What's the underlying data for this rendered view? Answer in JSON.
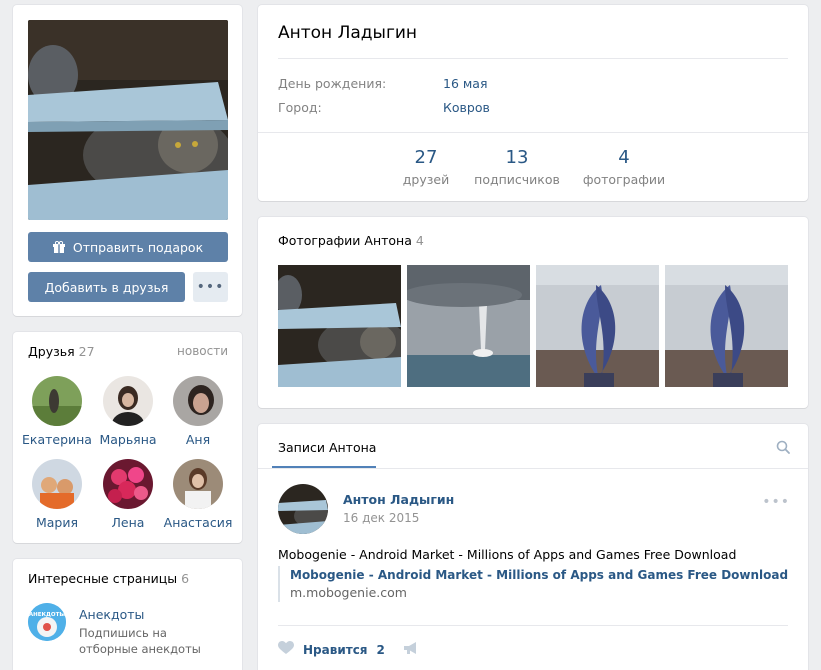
{
  "profile": {
    "name": "Антон Ладыгин",
    "info": [
      {
        "label": "День рождения:",
        "value": "16 мая"
      },
      {
        "label": "Город:",
        "value": "Ковров"
      }
    ],
    "stats": [
      {
        "count": "27",
        "label": "друзей"
      },
      {
        "count": "13",
        "label": "подписчиков"
      },
      {
        "count": "4",
        "label": "фотографии"
      }
    ]
  },
  "actions": {
    "gift_label": "Отправить подарок",
    "add_friend_label": "Добавить в друзья",
    "more_label": "•••"
  },
  "friends": {
    "title": "Друзья",
    "count": "27",
    "news_link": "новости",
    "items": [
      {
        "name": "Екатерина"
      },
      {
        "name": "Марьяна"
      },
      {
        "name": "Аня"
      },
      {
        "name": "Мария"
      },
      {
        "name": "Лена"
      },
      {
        "name": "Анастасия"
      }
    ]
  },
  "pages": {
    "title": "Интересные страницы",
    "count": "6",
    "items": [
      {
        "name": "Анекдоты",
        "description": "Подпишись на отборные анекдоты",
        "avatar_text": "АНЕКДОТЫ"
      }
    ]
  },
  "photos": {
    "title": "Фотографии Антона",
    "count": "4"
  },
  "wall": {
    "tab": "Записи Антона",
    "post": {
      "author": "Антон Ладыгин",
      "date": "16 дек 2015",
      "more": "•••",
      "text": "Mobogenie - Android Market - Millions of Apps and Games Free Download",
      "link_title": "Mobogenie - Android Market - Millions of Apps and Games Free Download",
      "link_domain": "m.mobogenie.com",
      "like_label": "Нравится",
      "like_count": "2"
    }
  },
  "colors": {
    "accent": "#5e81a8",
    "link": "#2a5885",
    "background": "#edeef0"
  }
}
